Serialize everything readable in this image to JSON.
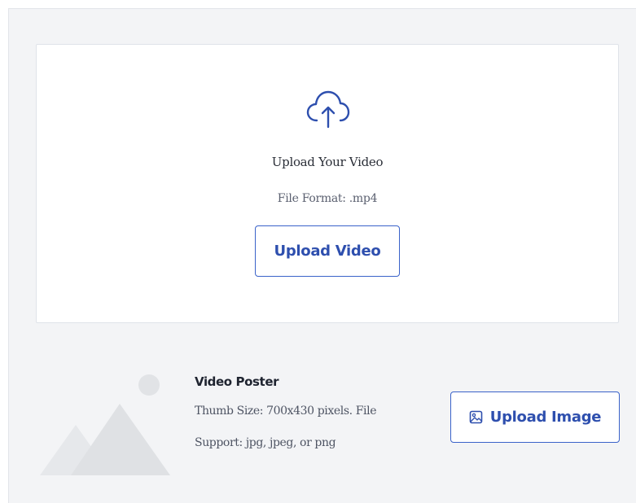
{
  "upload_video": {
    "icon": "cloud-upload-icon",
    "title": "Upload Your Video",
    "format": "File Format: .mp4",
    "button_label": "Upload Video"
  },
  "video_poster": {
    "illustration": "image-placeholder-icon",
    "title": "Video Poster",
    "description_line1": "Thumb Size: 700x430 pixels. File",
    "description_line2": "Support: jpg, jpeg, or png",
    "button_icon": "image-icon",
    "button_label": "Upload Image"
  },
  "colors": {
    "accent": "#2e4fae",
    "panel_background": "#f3f4f6",
    "placeholder_gray": "#e3e5e8"
  }
}
